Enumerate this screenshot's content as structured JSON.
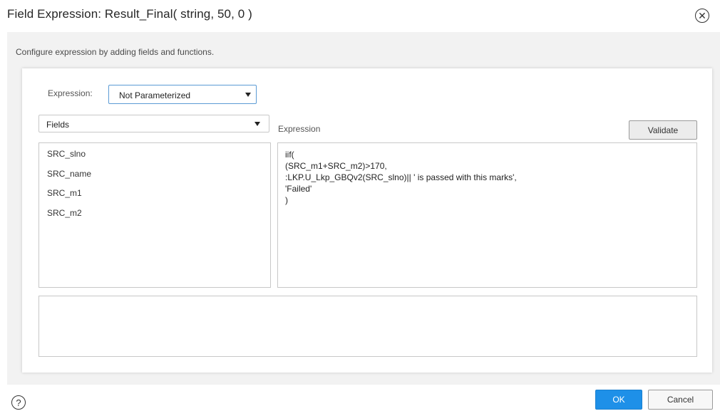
{
  "dialog": {
    "title": "Field Expression: Result_Final( string, 50, 0 )",
    "close_icon": "close-circle-icon",
    "subtitle": "Configure expression by adding fields and functions."
  },
  "expression_param": {
    "label": "Expression:",
    "selected": "Not Parameterized"
  },
  "fields_panel": {
    "selected": "Fields",
    "items": [
      {
        "label": "SRC_slno"
      },
      {
        "label": "SRC_name"
      },
      {
        "label": "SRC_m1"
      },
      {
        "label": "SRC_m2"
      }
    ]
  },
  "expression_panel": {
    "title": "Expression",
    "validate_label": "Validate",
    "value": "iif(\n(SRC_m1+SRC_m2)>170,\n:LKP.U_Lkp_GBQv2(SRC_slno)|| ' is passed with this marks',\n'Failed'\n)"
  },
  "footer": {
    "help_icon": "help-circle-icon",
    "ok_label": "OK",
    "cancel_label": "Cancel"
  },
  "colors": {
    "primary": "#1e90e8",
    "focus_border": "#5b9bd5",
    "background": "#f2f2f2"
  }
}
